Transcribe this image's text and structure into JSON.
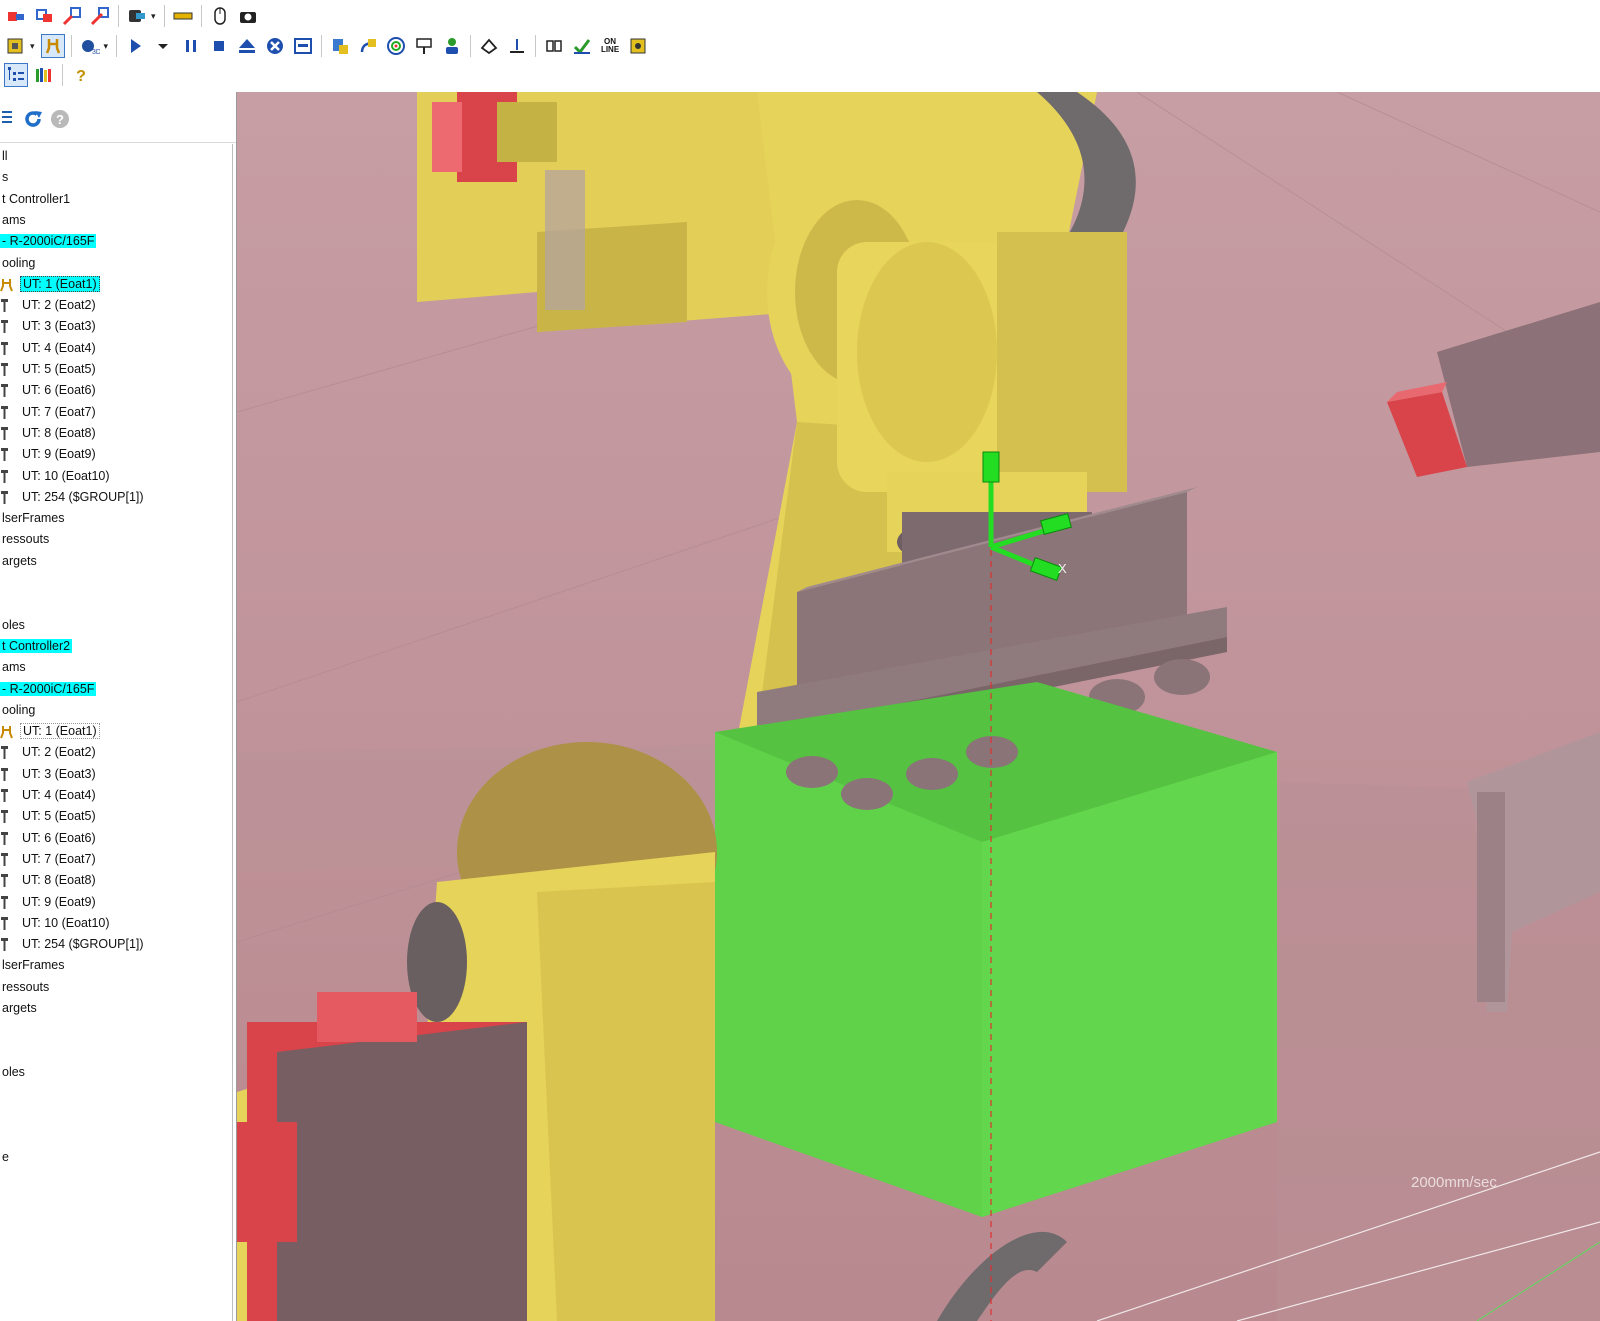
{
  "toolbar": {
    "rows": [
      [
        {
          "icon": "add-robot-icon"
        },
        {
          "icon": "add-fixture-icon"
        },
        {
          "icon": "add-part-icon"
        },
        {
          "icon": "add-obstacle-icon"
        },
        {
          "sep": true
        },
        {
          "icon": "teach-pendant-icon",
          "dropdown": true
        },
        {
          "sep": true
        },
        {
          "icon": "ruler-icon"
        },
        {
          "sep": true
        },
        {
          "icon": "mouse-icon"
        },
        {
          "icon": "camera-icon"
        }
      ],
      [
        {
          "icon": "cell-browser-icon",
          "dropdown": true
        },
        {
          "icon": "gripper-icon",
          "pressed": true
        },
        {
          "sep": true
        },
        {
          "icon": "3d-view-icon",
          "dropdown": true
        },
        {
          "sep": true
        },
        {
          "icon": "play-icon"
        },
        {
          "icon": "run-dropdown-icon"
        },
        {
          "icon": "pause-icon"
        },
        {
          "icon": "stop-icon"
        },
        {
          "icon": "eject-icon"
        },
        {
          "icon": "abort-icon"
        },
        {
          "icon": "display-icon"
        },
        {
          "sep": true
        },
        {
          "icon": "robot-program-icon"
        },
        {
          "icon": "jog-frame-icon"
        },
        {
          "icon": "target-icon"
        },
        {
          "icon": "sign-icon"
        },
        {
          "icon": "operator-icon"
        },
        {
          "sep": true
        },
        {
          "icon": "measure-icon"
        },
        {
          "icon": "tool-offset-icon"
        },
        {
          "sep": true
        },
        {
          "icon": "io-icon"
        },
        {
          "icon": "download-icon"
        },
        {
          "icon": "online-icon",
          "text": "ON\nLINE"
        },
        {
          "icon": "robot-settings-icon"
        }
      ],
      [
        {
          "icon": "tree-view-icon",
          "pressed": true
        },
        {
          "icon": "library-icon"
        },
        {
          "sep": true
        },
        {
          "icon": "help-icon"
        }
      ]
    ]
  },
  "panel": {
    "toolbar_icons": [
      "tree-view-icon",
      "refresh-icon",
      "help-icon"
    ]
  },
  "tree": {
    "items": [
      {
        "label": "ll"
      },
      {
        "label": "s"
      },
      {
        "label": "t Controller1"
      },
      {
        "label": "ams"
      },
      {
        "label": "- R-2000iC/165F",
        "style": "sel"
      },
      {
        "label": "ooling"
      },
      {
        "label": "UT: 1  (Eoat1)",
        "icon": "gripper",
        "style": "frame"
      },
      {
        "label": "UT: 2  (Eoat2)",
        "icon": "tool"
      },
      {
        "label": "UT: 3  (Eoat3)",
        "icon": "tool"
      },
      {
        "label": "UT: 4  (Eoat4)",
        "icon": "tool"
      },
      {
        "label": "UT: 5  (Eoat5)",
        "icon": "tool"
      },
      {
        "label": "UT: 6  (Eoat6)",
        "icon": "tool"
      },
      {
        "label": "UT: 7  (Eoat7)",
        "icon": "tool"
      },
      {
        "label": "UT: 8  (Eoat8)",
        "icon": "tool"
      },
      {
        "label": "UT: 9  (Eoat9)",
        "icon": "tool"
      },
      {
        "label": "UT: 10  (Eoat10)",
        "icon": "tool"
      },
      {
        "label": "UT: 254  ($GROUP[1])",
        "icon": "tool"
      },
      {
        "label": "lserFrames"
      },
      {
        "label": "ressouts"
      },
      {
        "label": "argets"
      },
      {
        "label": ""
      },
      {
        "label": ""
      },
      {
        "label": "oles"
      },
      {
        "label": "t Controller2",
        "style": "sel"
      },
      {
        "label": "ams"
      },
      {
        "label": "- R-2000iC/165F",
        "style": "sel"
      },
      {
        "label": "ooling"
      },
      {
        "label": "UT: 1  (Eoat1)",
        "icon": "gripper",
        "style": "box"
      },
      {
        "label": "UT: 2  (Eoat2)",
        "icon": "tool"
      },
      {
        "label": "UT: 3  (Eoat3)",
        "icon": "tool"
      },
      {
        "label": "UT: 4  (Eoat4)",
        "icon": "tool"
      },
      {
        "label": "UT: 5  (Eoat5)",
        "icon": "tool"
      },
      {
        "label": "UT: 6  (Eoat6)",
        "icon": "tool"
      },
      {
        "label": "UT: 7  (Eoat7)",
        "icon": "tool"
      },
      {
        "label": "UT: 8  (Eoat8)",
        "icon": "tool"
      },
      {
        "label": "UT: 9  (Eoat9)",
        "icon": "tool"
      },
      {
        "label": "UT: 10  (Eoat10)",
        "icon": "tool"
      },
      {
        "label": "UT: 254  ($GROUP[1])",
        "icon": "tool"
      },
      {
        "label": "lserFrames"
      },
      {
        "label": "ressouts"
      },
      {
        "label": "argets"
      },
      {
        "label": ""
      },
      {
        "label": ""
      },
      {
        "label": "oles"
      },
      {
        "label": ""
      },
      {
        "label": ""
      },
      {
        "label": ""
      },
      {
        "label": "e"
      }
    ]
  },
  "viewport": {
    "speed_readout": "2000mm/sec",
    "axis_label": "X",
    "colors": {
      "background": "#c79ea4",
      "robot_yellow": "#e6d35a",
      "motor_red": "#d9444a",
      "part_green": "#5fd24a",
      "gripper_gray": "#8c7579",
      "frame_green": "#22dd22"
    }
  }
}
